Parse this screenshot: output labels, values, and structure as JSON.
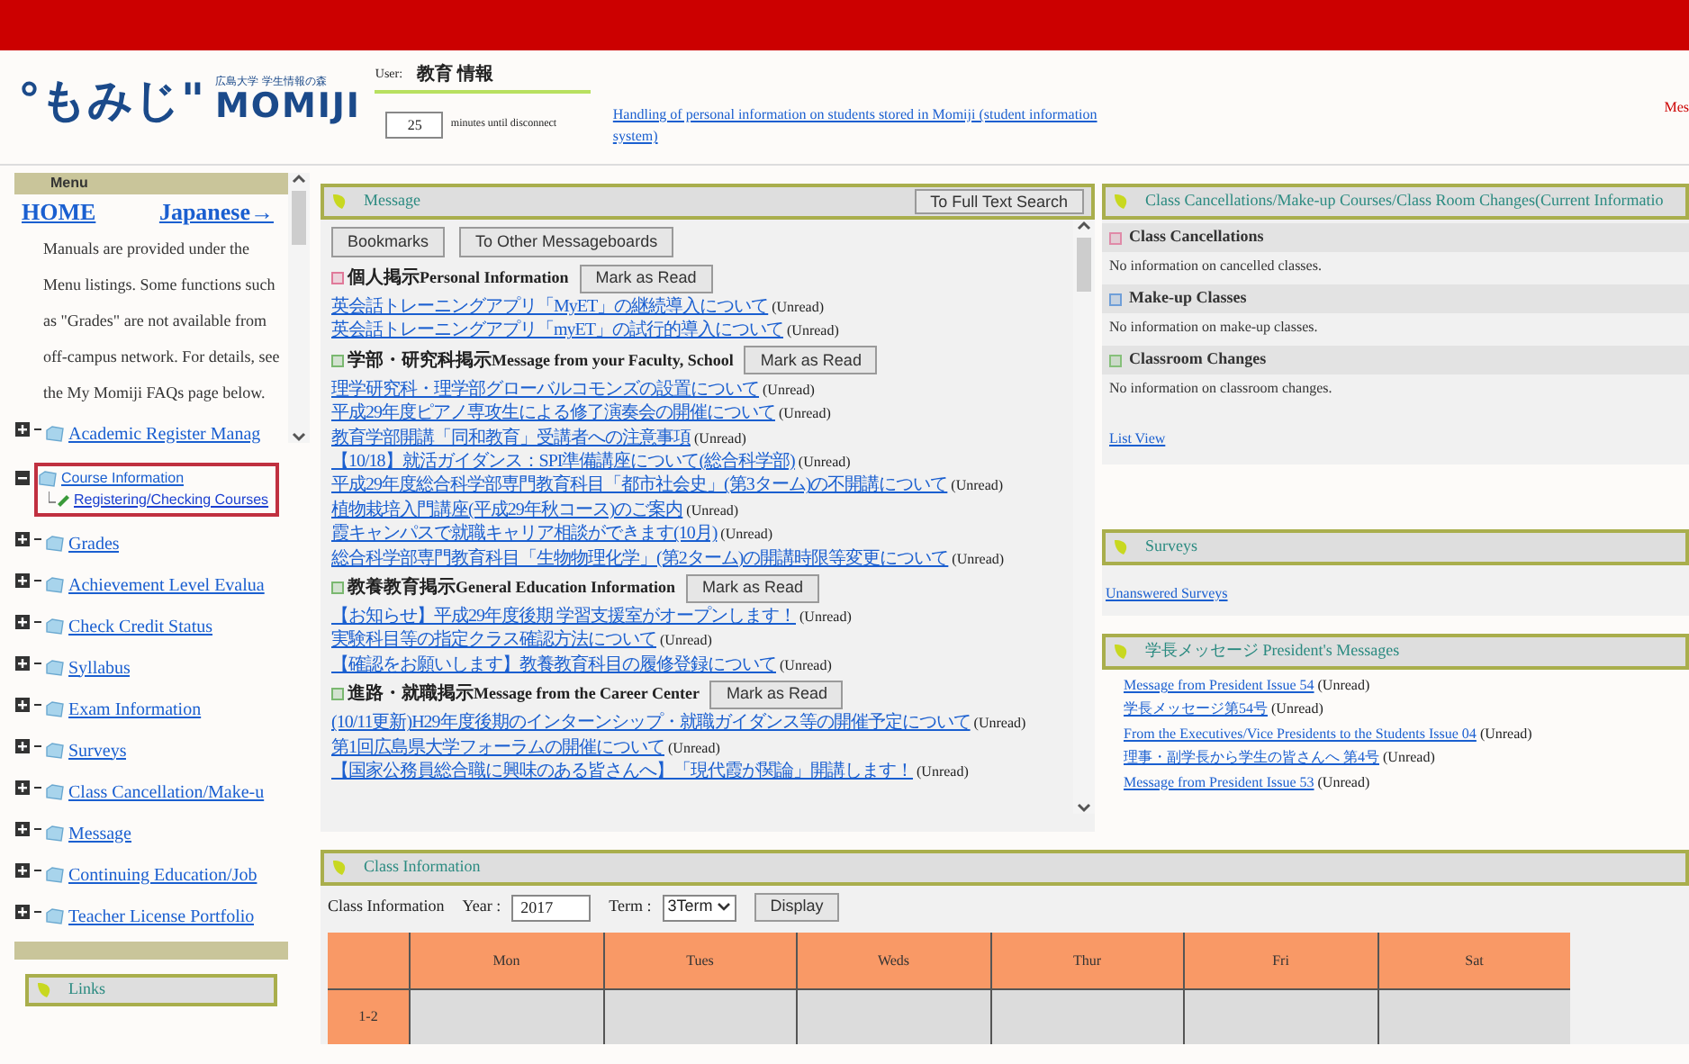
{
  "header": {
    "logo_mark": "°もみじ\"",
    "logo_text": "MOMIJI",
    "logo_caption": "広島大学 学生情報の森",
    "user_label": "User:",
    "user_name": "教育 情報",
    "timeout": "25",
    "timeout_label": "minutes until disconnect",
    "notice_link": "Handling of personal information on students stored in Momiji (student information system)",
    "right_text": "Mes"
  },
  "menu": {
    "title": "Menu",
    "home": "HOME",
    "language": "Japanese→",
    "intro": "Manuals are provided under the Menu listings. Some functions such as \"Grades\" are not available from off-campus network. For details, see the My Momiji FAQs page below.",
    "items": [
      {
        "label": "Academic Register Manag",
        "expanded": false,
        "highlighted": false
      },
      {
        "label": "Course Information",
        "expanded": true,
        "highlighted": true,
        "children": [
          {
            "label": "Registering/Checking Courses"
          }
        ]
      },
      {
        "label": "Grades",
        "expanded": false,
        "highlighted": false
      },
      {
        "label": "Achievement Level Evalua",
        "expanded": false,
        "highlighted": false
      },
      {
        "label": "Check Credit Status",
        "expanded": false,
        "highlighted": false
      },
      {
        "label": "Syllabus",
        "expanded": false,
        "highlighted": false
      },
      {
        "label": "Exam Information",
        "expanded": false,
        "highlighted": false
      },
      {
        "label": "Surveys",
        "expanded": false,
        "highlighted": false
      },
      {
        "label": "Class Cancellation/Make-u",
        "expanded": false,
        "highlighted": false
      },
      {
        "label": "Message",
        "expanded": false,
        "highlighted": false
      },
      {
        "label": "Continuing Education/Job",
        "expanded": false,
        "highlighted": false
      },
      {
        "label": "Teacher License Portfolio",
        "expanded": false,
        "highlighted": false
      }
    ],
    "links_title": "Links"
  },
  "message": {
    "title": "Message",
    "search_button": "To Full Text Search",
    "buttons": [
      "Bookmarks",
      "To Other Messageboards"
    ],
    "sections": [
      {
        "title_ja": "個人掲示",
        "title_en": "Personal Information",
        "color": "#e07a9a",
        "button": "Mark as Read",
        "items": [
          {
            "title": "英会話トレーニングアプリ「MyET」の継続導入について",
            "status": "(Unread)"
          },
          {
            "title": "英会話トレーニングアプリ「myET」の試行的導入について",
            "status": "(Unread)"
          }
        ]
      },
      {
        "title_ja": "学部・研究科掲示",
        "title_en": "Message from your Faculty, School",
        "color": "#7ab870",
        "button": "Mark as Read",
        "items": [
          {
            "title": "理学研究科・理学部グローバルコモンズの設置について",
            "status": "(Unread)"
          },
          {
            "title": "平成29年度ピアノ専攻生による修了演奏会の開催について",
            "status": "(Unread)"
          },
          {
            "title": "教育学部開講「同和教育」受講者への注意事項",
            "status": "(Unread)"
          },
          {
            "title": "【10/18】就活ガイダンス：SPI準備講座について(総合科学部)",
            "status": "(Unread)"
          },
          {
            "title": "平成29年度総合科学部専門教育科目「都市社会史」(第3ターム)の不開講について",
            "status": "(Unread)"
          },
          {
            "title": "植物栽培入門講座(平成29年秋コース)のご案内",
            "status": "(Unread)"
          },
          {
            "title": "霞キャンパスで就職キャリア相談ができます(10月)",
            "status": "(Unread)"
          },
          {
            "title": "総合科学部専門教育科目「生物物理化学」(第2ターム)の開講時限等変更について",
            "status": "(Unread)"
          }
        ]
      },
      {
        "title_ja": "教養教育掲示",
        "title_en": "General Education Information",
        "color": "#7ab870",
        "button": "Mark as Read",
        "items": [
          {
            "title": "【お知らせ】平成29年度後期 学習支援室がオープンします！",
            "status": "(Unread)"
          },
          {
            "title": "実験科目等の指定クラス確認方法について",
            "status": "(Unread)"
          },
          {
            "title": "【確認をお願いします】教養教育科目の履修登録について",
            "status": "(Unread)"
          }
        ]
      },
      {
        "title_ja": "進路・就職掲示",
        "title_en": "Message from the Career Center",
        "color": "#7ab870",
        "button": "Mark as Read",
        "items": [
          {
            "title": "(10/11更新)H29年度後期のインターンシップ・就職ガイダンス等の開催予定について",
            "status": "(Unread)"
          },
          {
            "title": "第1回広島県大学フォーラムの開催について",
            "status": "(Unread)"
          },
          {
            "title": "【国家公務員総合職に興味のある皆さんへ】「現代霞が関論」開講します！",
            "status": "(Unread)"
          }
        ]
      }
    ]
  },
  "changes": {
    "title": "Class Cancellations/Make-up Courses/Class Room Changes(Current Informatio",
    "sections": [
      {
        "title": "Class Cancellations",
        "color": "#e08aa8",
        "text": "No information on cancelled classes."
      },
      {
        "title": "Make-up Classes",
        "color": "#6f9fd8",
        "text": "No information on make-up classes."
      },
      {
        "title": "Classroom Changes",
        "color": "#86c07a",
        "text": "No information on classroom changes."
      }
    ],
    "list_view": "List View"
  },
  "surveys": {
    "title": "Surveys",
    "link": "Unanswered Surveys"
  },
  "president": {
    "title": "学長メッセージ President's Messages",
    "items": [
      {
        "title": "Message from President Issue 54",
        "status": "(Unread)"
      },
      {
        "title": "学長メッセージ第54号",
        "status": "(Unread)"
      },
      {
        "title": "From the Executives/Vice Presidents to the Students Issue 04",
        "status": "(Unread)"
      },
      {
        "title": "理事・副学長から学生の皆さんへ 第4号",
        "status": "(Unread)"
      },
      {
        "title": "Message from President Issue 53",
        "status": "(Unread)"
      }
    ]
  },
  "class_info": {
    "title": "Class Information",
    "label": "Class Information",
    "year_label": "Year :",
    "year": "2017",
    "term_label": "Term :",
    "term": "3Term",
    "display_button": "Display",
    "days": [
      "Mon",
      "Tues",
      "Weds",
      "Thur",
      "Fri",
      "Sat"
    ],
    "rows": [
      {
        "period": "1-2"
      }
    ]
  }
}
